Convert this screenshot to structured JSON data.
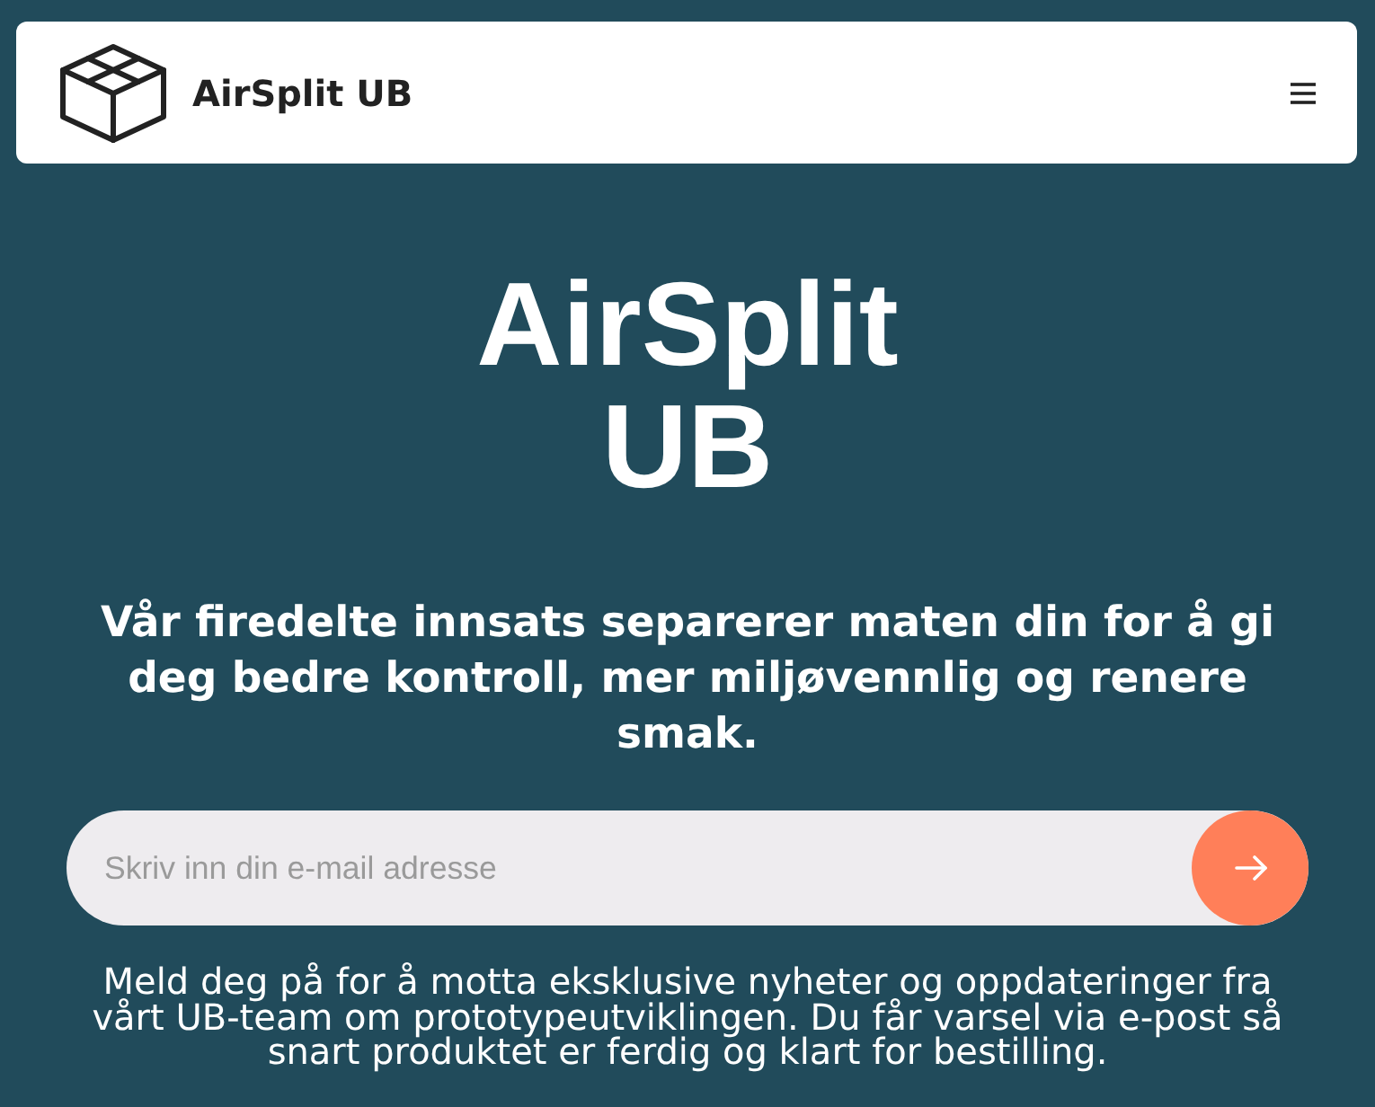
{
  "header": {
    "brand": "AirSplit UB"
  },
  "hero": {
    "title": "AirSplit UB",
    "subtitle": "Vår firedelte innsats separerer maten din for å gi deg bedre kontroll, mer miljøvennlig og renere smak.",
    "signup": {
      "placeholder": "Skriv inn din e-mail adresse"
    },
    "note": "Meld deg på for å motta eksklusive nyheter og oppdateringer fra vårt UB-team om prototypeutviklingen. Du får varsel via e-post så snart produktet er ferdig og klart for bestilling."
  }
}
